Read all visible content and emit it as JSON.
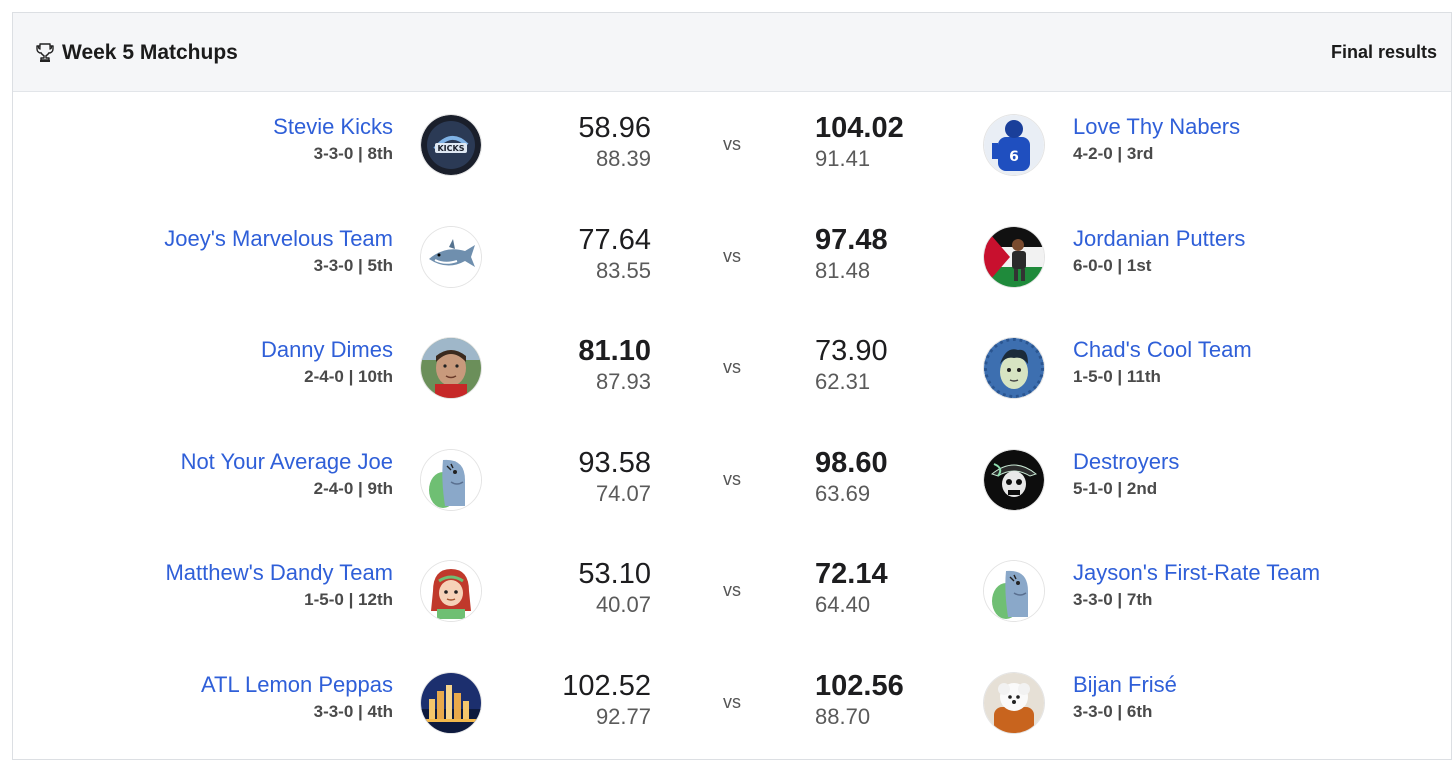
{
  "header": {
    "title": "Week 5 Matchups",
    "status": "Final results",
    "icon": "trophy-icon"
  },
  "vs_label": "vs",
  "matchups": [
    {
      "left": {
        "name": "Stevie Kicks",
        "record": "3-3-0 | 8th",
        "score": "58.96",
        "projected": "88.39",
        "avatar": "kicks-logo-avatar"
      },
      "right": {
        "name": "Love Thy Nabers",
        "record": "4-2-0 | 3rd",
        "score": "104.02",
        "projected": "91.41",
        "avatar": "giants-player-avatar"
      },
      "winner": "right"
    },
    {
      "left": {
        "name": "Joey's Marvelous Team",
        "record": "3-3-0 | 5th",
        "score": "77.64",
        "projected": "83.55",
        "avatar": "shark-avatar"
      },
      "right": {
        "name": "Jordanian Putters",
        "record": "6-0-0 | 1st",
        "score": "97.48",
        "projected": "81.48",
        "avatar": "golfer-flag-avatar"
      },
      "winner": "right"
    },
    {
      "left": {
        "name": "Danny Dimes",
        "record": "2-4-0 | 10th",
        "score": "81.10",
        "projected": "87.93",
        "avatar": "man-photo-avatar"
      },
      "right": {
        "name": "Chad's Cool Team",
        "record": "1-5-0 | 11th",
        "score": "73.90",
        "projected": "62.31",
        "avatar": "cartoon-face-avatar"
      },
      "winner": "left"
    },
    {
      "left": {
        "name": "Not Your Average Joe",
        "record": "2-4-0 | 9th",
        "score": "93.58",
        "projected": "74.07",
        "avatar": "dino-avatar"
      },
      "right": {
        "name": "Destroyers",
        "record": "5-1-0 | 2nd",
        "score": "98.60",
        "projected": "63.69",
        "avatar": "pirate-skull-avatar"
      },
      "winner": "right"
    },
    {
      "left": {
        "name": "Matthew's Dandy Team",
        "record": "1-5-0 | 12th",
        "score": "53.10",
        "projected": "40.07",
        "avatar": "redhead-avatar"
      },
      "right": {
        "name": "Jayson's First-Rate Team",
        "record": "3-3-0 | 7th",
        "score": "72.14",
        "projected": "64.40",
        "avatar": "dino-avatar"
      },
      "winner": "right"
    },
    {
      "left": {
        "name": "ATL Lemon Peppas",
        "record": "3-3-0 | 4th",
        "score": "102.52",
        "projected": "92.77",
        "avatar": "city-skyline-avatar"
      },
      "right": {
        "name": "Bijan Frisé",
        "record": "3-3-0 | 6th",
        "score": "102.56",
        "projected": "88.70",
        "avatar": "dog-football-avatar"
      },
      "winner": "right"
    }
  ]
}
